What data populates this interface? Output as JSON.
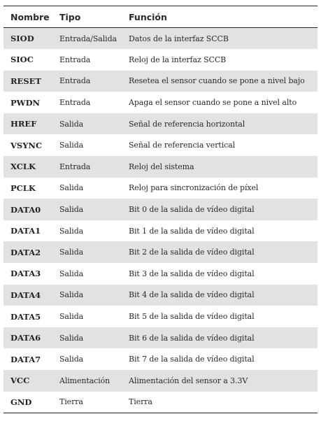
{
  "table": {
    "headers": {
      "name": "Nombre",
      "type": "Tipo",
      "function": "Función"
    },
    "rows": [
      {
        "name": "SIOD",
        "type": "Entrada/Salida",
        "function": "Datos de la interfaz SCCB"
      },
      {
        "name": "SIOC",
        "type": "Entrada",
        "function": "Reloj de la interfaz SCCB"
      },
      {
        "name": "RESET",
        "type": "Entrada",
        "function": "Resetea el sensor cuando se pone a nivel bajo"
      },
      {
        "name": "PWDN",
        "type": "Entrada",
        "function": "Apaga el sensor cuando se pone a nivel alto"
      },
      {
        "name": "HREF",
        "type": "Salida",
        "function": "Señal de referencia horizontal"
      },
      {
        "name": "VSYNC",
        "type": "Salida",
        "function": "Señal de referencia vertical"
      },
      {
        "name": "XCLK",
        "type": "Entrada",
        "function": "Reloj del sistema"
      },
      {
        "name": "PCLK",
        "type": "Salida",
        "function": "Reloj para sincronización de píxel"
      },
      {
        "name": "DATA0",
        "type": "Salida",
        "function": "Bit 0 de la salida de vídeo digital"
      },
      {
        "name": "DATA1",
        "type": "Salida",
        "function": "Bit 1 de la salida de vídeo digital"
      },
      {
        "name": "DATA2",
        "type": "Salida",
        "function": "Bit 2 de la salida de vídeo digital"
      },
      {
        "name": "DATA3",
        "type": "Salida",
        "function": "Bit 3 de la salida de vídeo digital"
      },
      {
        "name": "DATA4",
        "type": "Salida",
        "function": "Bit 4 de la salida de vídeo digital"
      },
      {
        "name": "DATA5",
        "type": "Salida",
        "function": "Bit 5 de la salida de vídeo digital"
      },
      {
        "name": "DATA6",
        "type": "Salida",
        "function": "Bit 6 de la salida de vídeo digital"
      },
      {
        "name": "DATA7",
        "type": "Salida",
        "function": "Bit 7 de la salida de vídeo digital"
      },
      {
        "name": "VCC",
        "type": "Alimentación",
        "function": "Alimentación del sensor a 3.3V"
      },
      {
        "name": "GND",
        "type": "Tierra",
        "function": "Tierra"
      }
    ]
  }
}
